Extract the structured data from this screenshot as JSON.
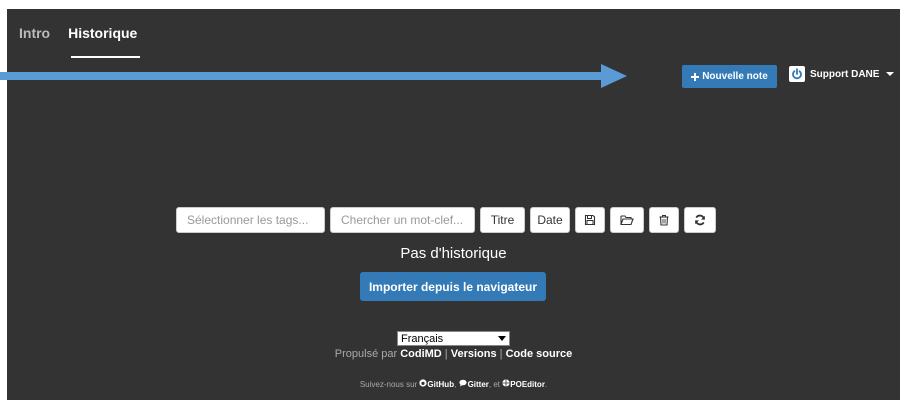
{
  "nav": {
    "tabs": [
      {
        "label": "Intro"
      },
      {
        "label": "Historique"
      }
    ]
  },
  "header": {
    "new_note_icon": "plus-icon",
    "new_note_label": "Nouvelle note",
    "user_icon": "power-icon",
    "user_name": "Support DANE"
  },
  "toolbar": {
    "tags_placeholder": "Sélectionner les tags...",
    "search_placeholder": "Chercher un mot-clef...",
    "sort_title_label": "Titre",
    "sort_date_label": "Date",
    "icons": [
      "save-icon",
      "folder-open-icon",
      "trash-icon",
      "refresh-icon"
    ]
  },
  "main": {
    "empty_label": "Pas d'historique",
    "import_label": "Importer depuis le navigateur"
  },
  "footer": {
    "language": "Français",
    "powered_by": "Propulsé par",
    "codimd": "CodiMD",
    "sep1": " | ",
    "versions": "Versions",
    "sep2": " | ",
    "source": "Code source",
    "follow_prefix": "Suivez-nous sur",
    "github": "GitHub",
    "comma": ",",
    "gitter": "Gitter",
    "and": ", et",
    "poeditor": "POEditor",
    "end": "."
  },
  "colors": {
    "background": "#333333",
    "accent": "#337ab7",
    "arrow": "#5b9bd5"
  }
}
